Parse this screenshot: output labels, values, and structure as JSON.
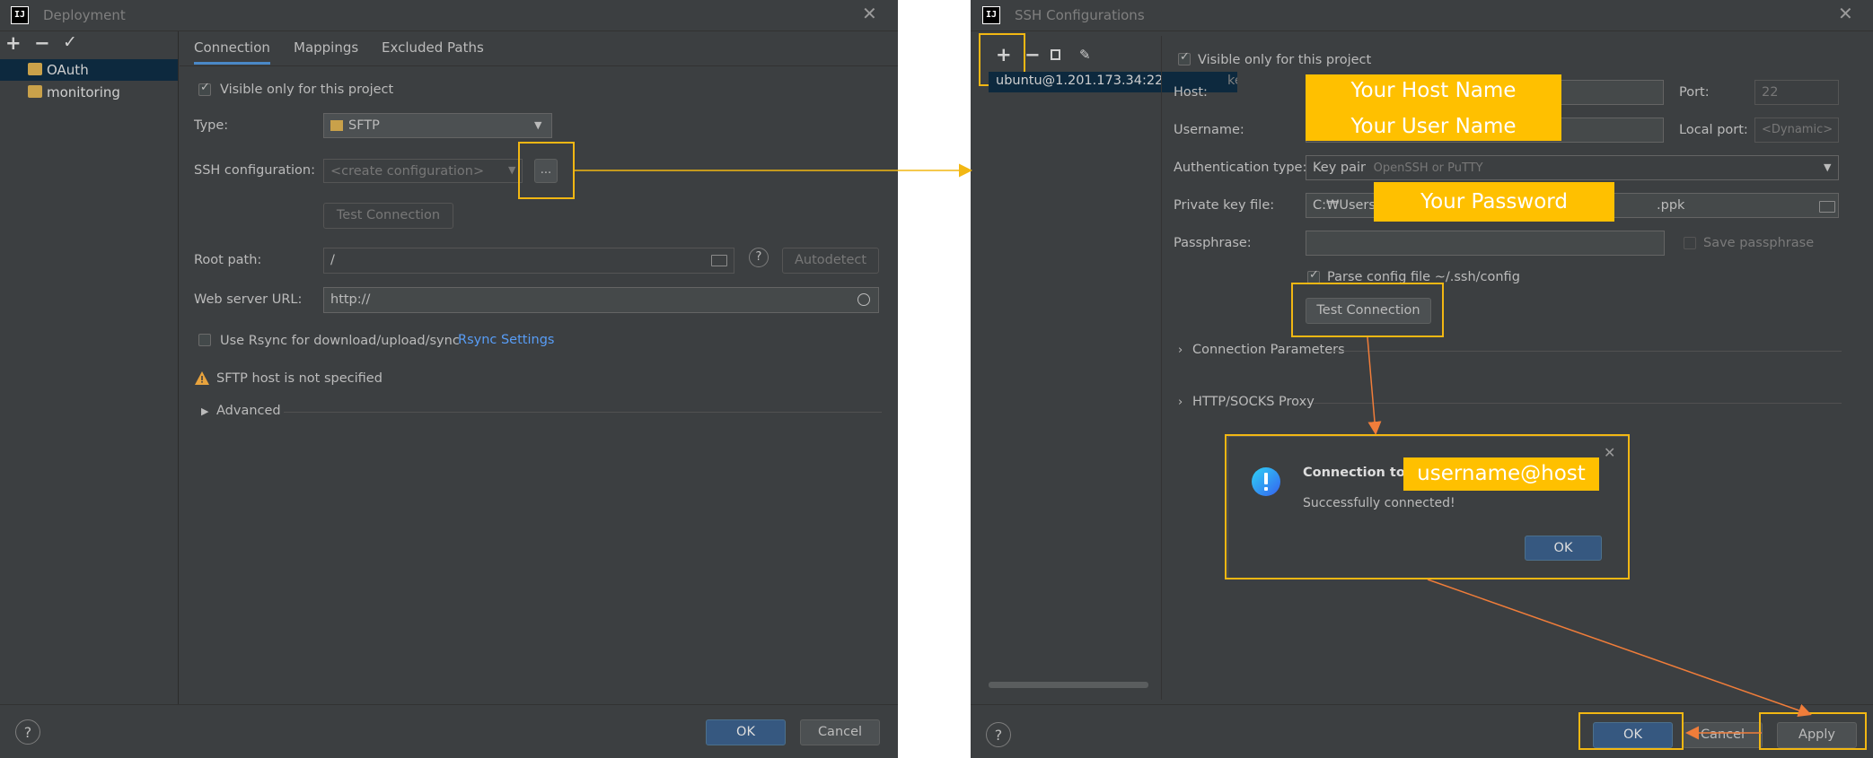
{
  "left": {
    "title": "Deployment",
    "toolbar": {
      "add": "+",
      "remove": "−",
      "check": "✓"
    },
    "servers": [
      {
        "name": "OAuth",
        "icon": "sftp-server-icon"
      },
      {
        "name": "monitoring",
        "icon": "sftp-server-icon"
      }
    ],
    "tabs": [
      "Connection",
      "Mappings",
      "Excluded Paths"
    ],
    "visible_only": "Visible only for this project",
    "type_label": "Type:",
    "type_value": "SFTP",
    "ssh_label": "SSH configuration:",
    "ssh_placeholder": "<create configuration>",
    "ellipsis": "...",
    "test_connection": "Test Connection",
    "root_path_label": "Root path:",
    "root_path_value": "/",
    "autodetect": "Autodetect",
    "web_url_label": "Web server URL:",
    "web_url_value": "http://",
    "rsync_label": "Use Rsync for download/upload/sync",
    "rsync_link": "Rsync Settings",
    "warning": "SFTP host is not specified",
    "advanced": "Advanced",
    "ok": "OK",
    "cancel": "Cancel",
    "help": "?"
  },
  "right": {
    "title": "SSH Configurations",
    "toolbar": {
      "add": "+",
      "remove": "−"
    },
    "config_item": "ubuntu@1.201.173.34:22",
    "config_item_suffix": "ke",
    "visible_only": "Visible only for this project",
    "host_label": "Host:",
    "port_label": "Port:",
    "port_value": "22",
    "username_label": "Username:",
    "local_port_label": "Local port:",
    "local_port_placeholder": "<Dynamic>",
    "auth_label": "Authentication type:",
    "auth_value": "Key pair",
    "auth_hint": "OpenSSH or PuTTY",
    "private_key_label": "Private key file:",
    "private_key_prefix": "C:₩Users₩",
    "private_key_suffix": ".ppk",
    "passphrase_label": "Passphrase:",
    "save_passphrase": "Save passphrase",
    "parse_config": "Parse config file ~/.ssh/config",
    "test_connection": "Test Connection",
    "conn_params": "Connection Parameters",
    "proxy": "HTTP/SOCKS Proxy",
    "ok": "OK",
    "cancel": "Cancel",
    "apply": "Apply",
    "help": "?"
  },
  "popup": {
    "title": "Connection to",
    "message": "Successfully connected!",
    "ok": "OK"
  },
  "annotations": {
    "host": "Your Host Name",
    "user": "Your User Name",
    "password": "Your Password",
    "target": "username@host"
  },
  "colors": {
    "dialog_bg": "#3c3f41",
    "highlight": "#f2b713",
    "annotation_fill": "#ffc000",
    "arrow_right": "#f2b713",
    "arrow_orange": "#f07d3a",
    "accent_blue": "#4a88c7"
  }
}
